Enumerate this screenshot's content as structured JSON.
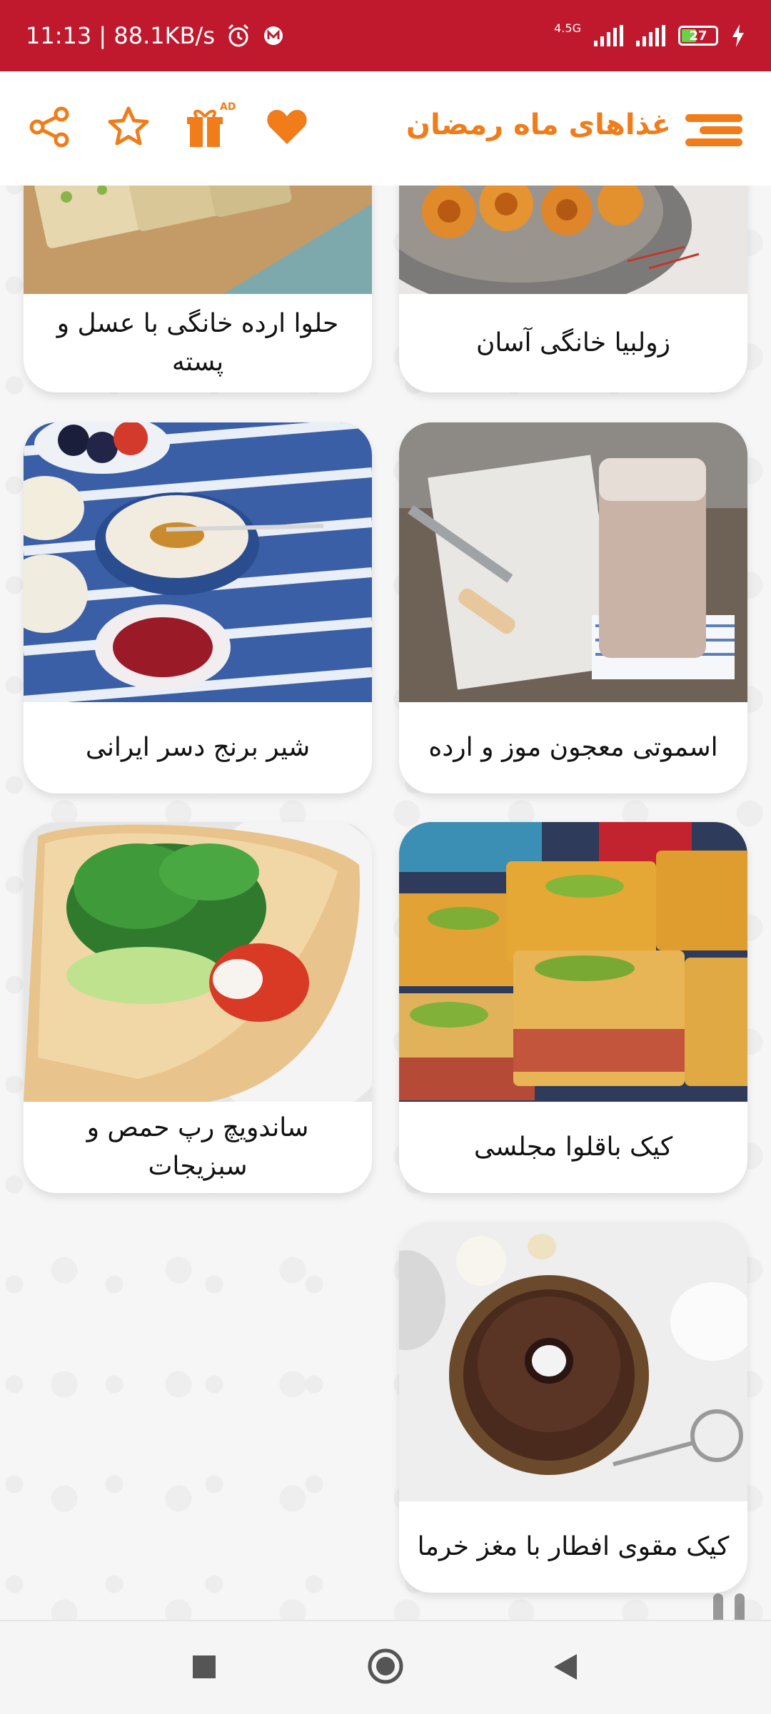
{
  "status_bar": {
    "time_speed": "11:13 | 88.1KB/s",
    "network": "4.5G",
    "battery": "27"
  },
  "app_bar": {
    "title": "غذاهای ماه رمضان",
    "ad_badge": "AD"
  },
  "recipes": [
    {
      "title": "زولبیا خانگی آسان"
    },
    {
      "title": "حلوا ارده خانگی با عسل و پسته"
    },
    {
      "title": "اسموتی معجون موز و ارده"
    },
    {
      "title": "شیر برنج دسر ایرانی"
    },
    {
      "title": "کیک باقلوا مجلسی"
    },
    {
      "title": "ساندویچ رپ حمص و سبزیجات"
    },
    {
      "title": "کیک مقوی افطار با مغز خرما"
    }
  ],
  "colors": {
    "status_bar": "#c0182c",
    "accent": "#f07c1a"
  }
}
